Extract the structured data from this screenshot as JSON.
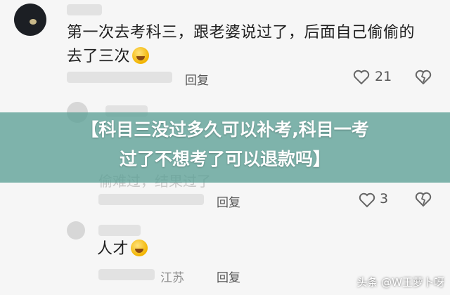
{
  "comments": [
    {
      "content_line1": "第一次去考科三，跟老婆说过了，后面自己偷偷的",
      "content_line2": "去了三次",
      "reply_label": "回复",
      "like_count": "21"
    },
    {
      "content_partial": "偷难过，结果过了",
      "reply_label": "回复",
      "like_count": "3"
    },
    {
      "content": "人才",
      "location": "江苏",
      "reply_label": "回复"
    }
  ],
  "banner": {
    "line1": "【科目三没过多久可以补考,科目一考",
    "line2": "过了不想考了可以退款吗】"
  },
  "watermark": "头条 @W王萝卜呀",
  "colors": {
    "banner_bg": "#5ca096",
    "background": "#f6f6f6"
  },
  "icons": [
    "heart-icon",
    "dislike-icon",
    "laughing-emoji-icon"
  ]
}
